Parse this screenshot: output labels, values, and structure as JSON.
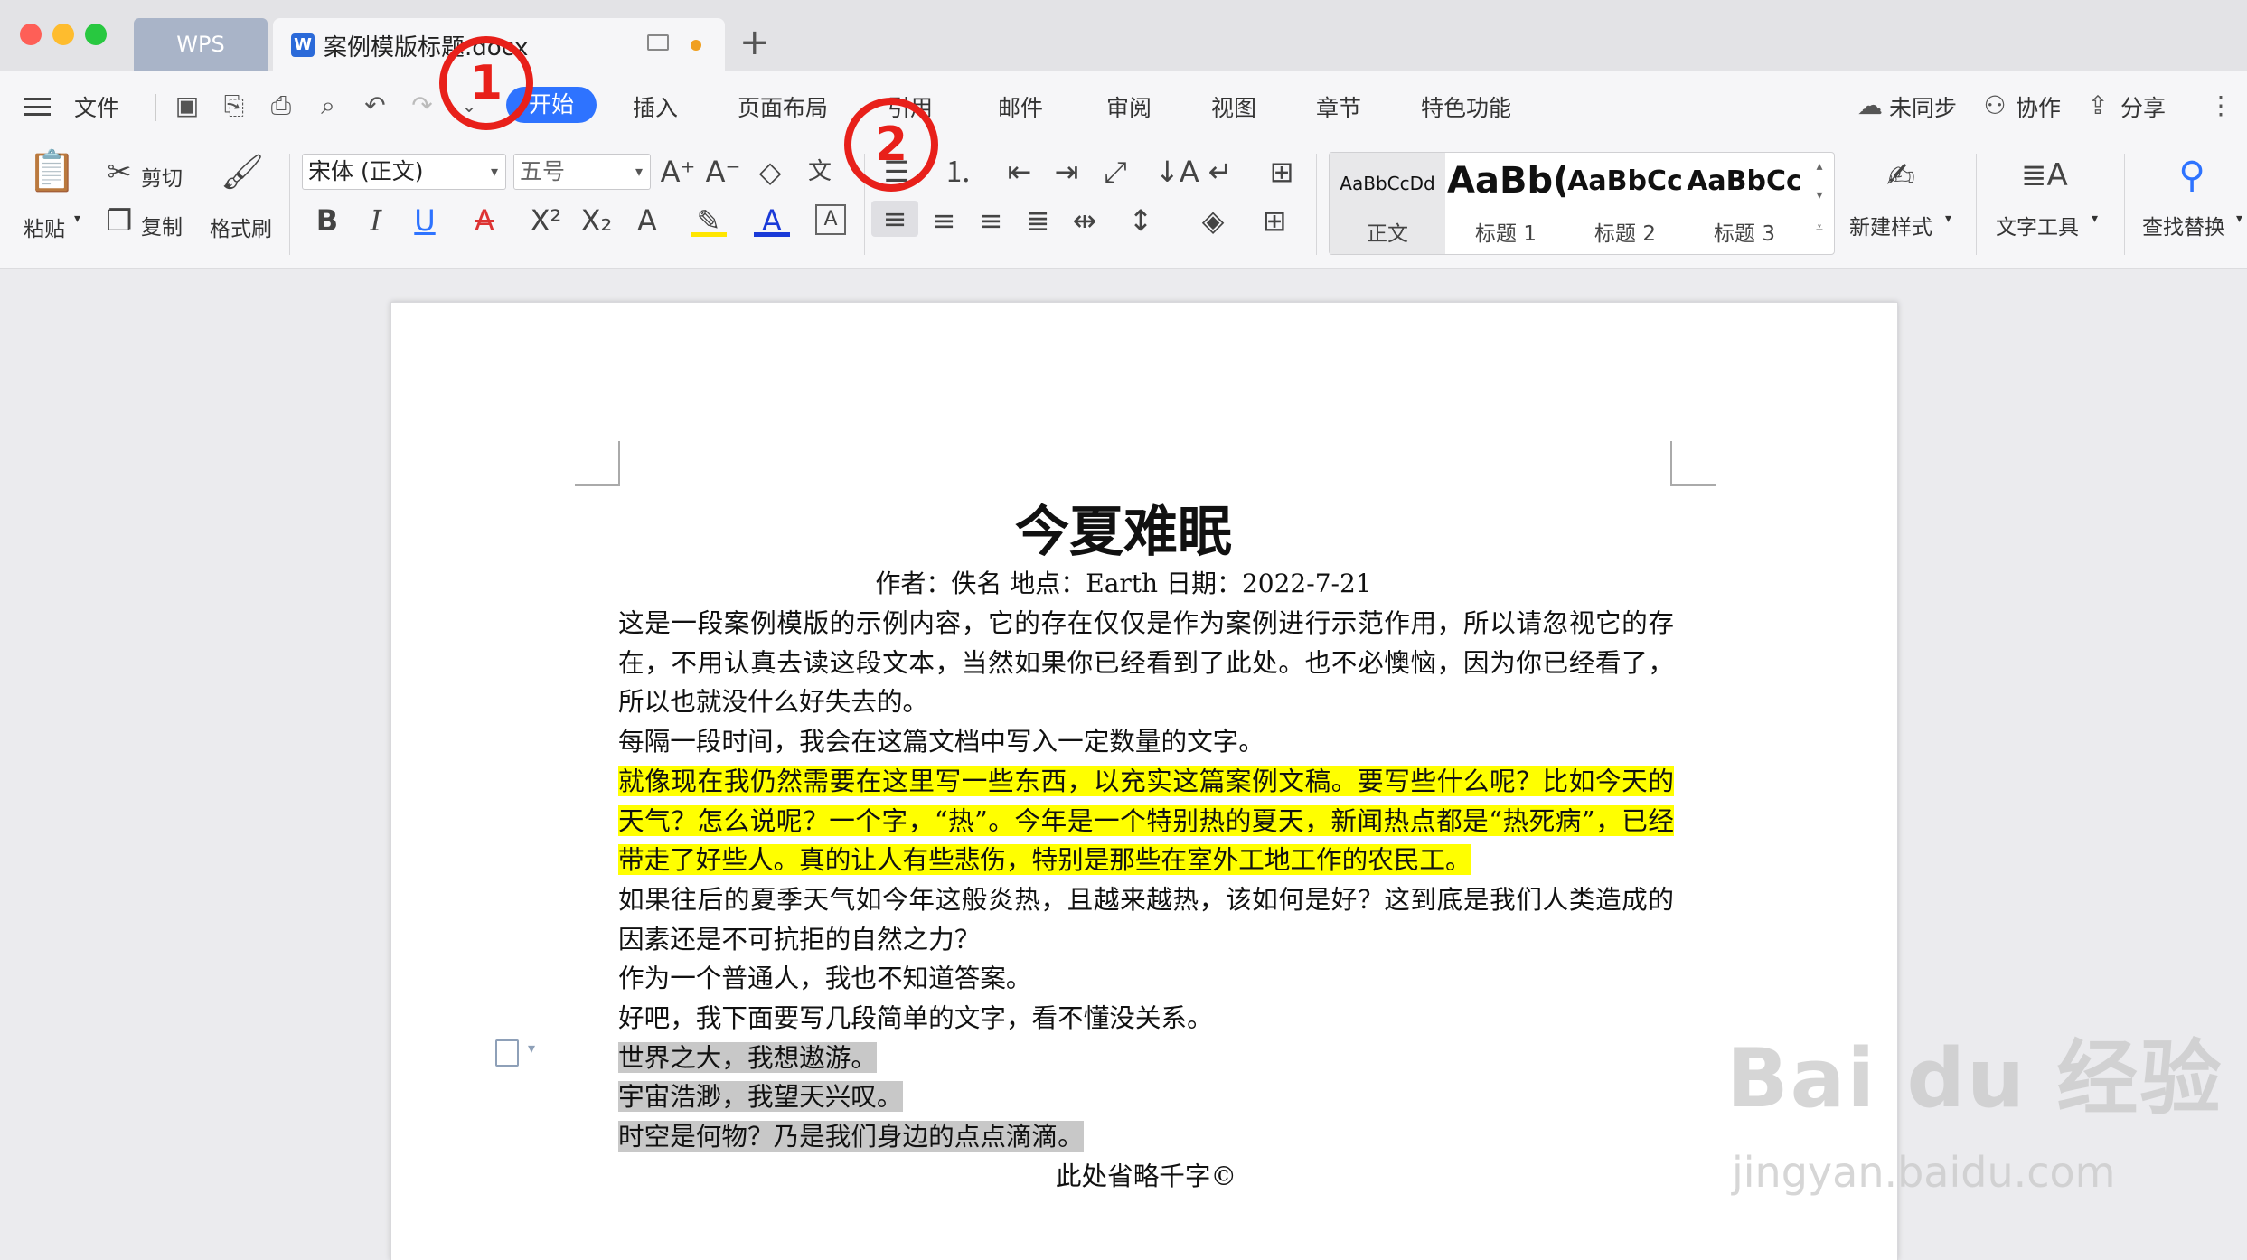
{
  "titlebar": {
    "app_tab": "WPS",
    "doc_tab": "案例模版标题.docx",
    "new_tab": "+"
  },
  "menu": {
    "file": "文件",
    "tabs": [
      "开始",
      "插入",
      "页面布局",
      "引用",
      "邮件",
      "审阅",
      "视图",
      "章节",
      "特色功能"
    ],
    "sync": "未同步",
    "collab": "协作",
    "share": "分享"
  },
  "ribbon": {
    "paste": "粘贴",
    "cut": "剪切",
    "copy": "复制",
    "format_painter": "格式刷",
    "font_name": "宋体 (正文)",
    "font_size": "五号",
    "styles": [
      {
        "preview": "AaBbCcDd",
        "label": "正文"
      },
      {
        "preview": "AaBb(",
        "label": "标题 1"
      },
      {
        "preview": "AaBbCc",
        "label": "标题 2"
      },
      {
        "preview": "AaBbCc",
        "label": "标题 3"
      }
    ],
    "new_style": "新建样式",
    "text_tools": "文字工具",
    "find_replace": "查找替换"
  },
  "annotations": {
    "step1": "1",
    "step2": "2"
  },
  "document": {
    "title": "今夏难眠",
    "meta": "作者：佚名 地点：Earth 日期：2022-7-21",
    "p1": "这是一段案例模版的示例内容，它的存在仅仅是作为案例进行示范作用，所以请忽视它的存在，不用认真去读这段文本，当然如果你已经看到了此处。也不必懊恼，因为你已经看了，所以也就没什么好失去的。",
    "p2": "每隔一段时间，我会在这篇文档中写入一定数量的文字。",
    "p3": "就像现在我仍然需要在这里写一些东西，以充实这篇案例文稿。要写些什么呢？比如今天的天气？怎么说呢？一个字，“热”。今年是一个特别热的夏天，新闻热点都是“热死病”，已经带走了好些人。真的让人有些悲伤，特别是那些在室外工地工作的农民工。",
    "p4": "如果往后的夏季天气如今年这般炎热，且越来越热，该如何是好？这到底是我们人类造成的因素还是不可抗拒的自然之力？",
    "p5": "作为一个普通人，我也不知道答案。",
    "p6": "好吧，我下面要写几段简单的文字，看不懂没关系。",
    "p7": "世界之大，我想遨游。",
    "p8": "宇宙浩渺，我望天兴叹。",
    "p9": "时空是何物？乃是我们身边的点点滴滴。",
    "p10": "此处省略千字©"
  },
  "watermark": {
    "brand": "Bai du 经验",
    "url": "jingyan.baidu.com"
  }
}
